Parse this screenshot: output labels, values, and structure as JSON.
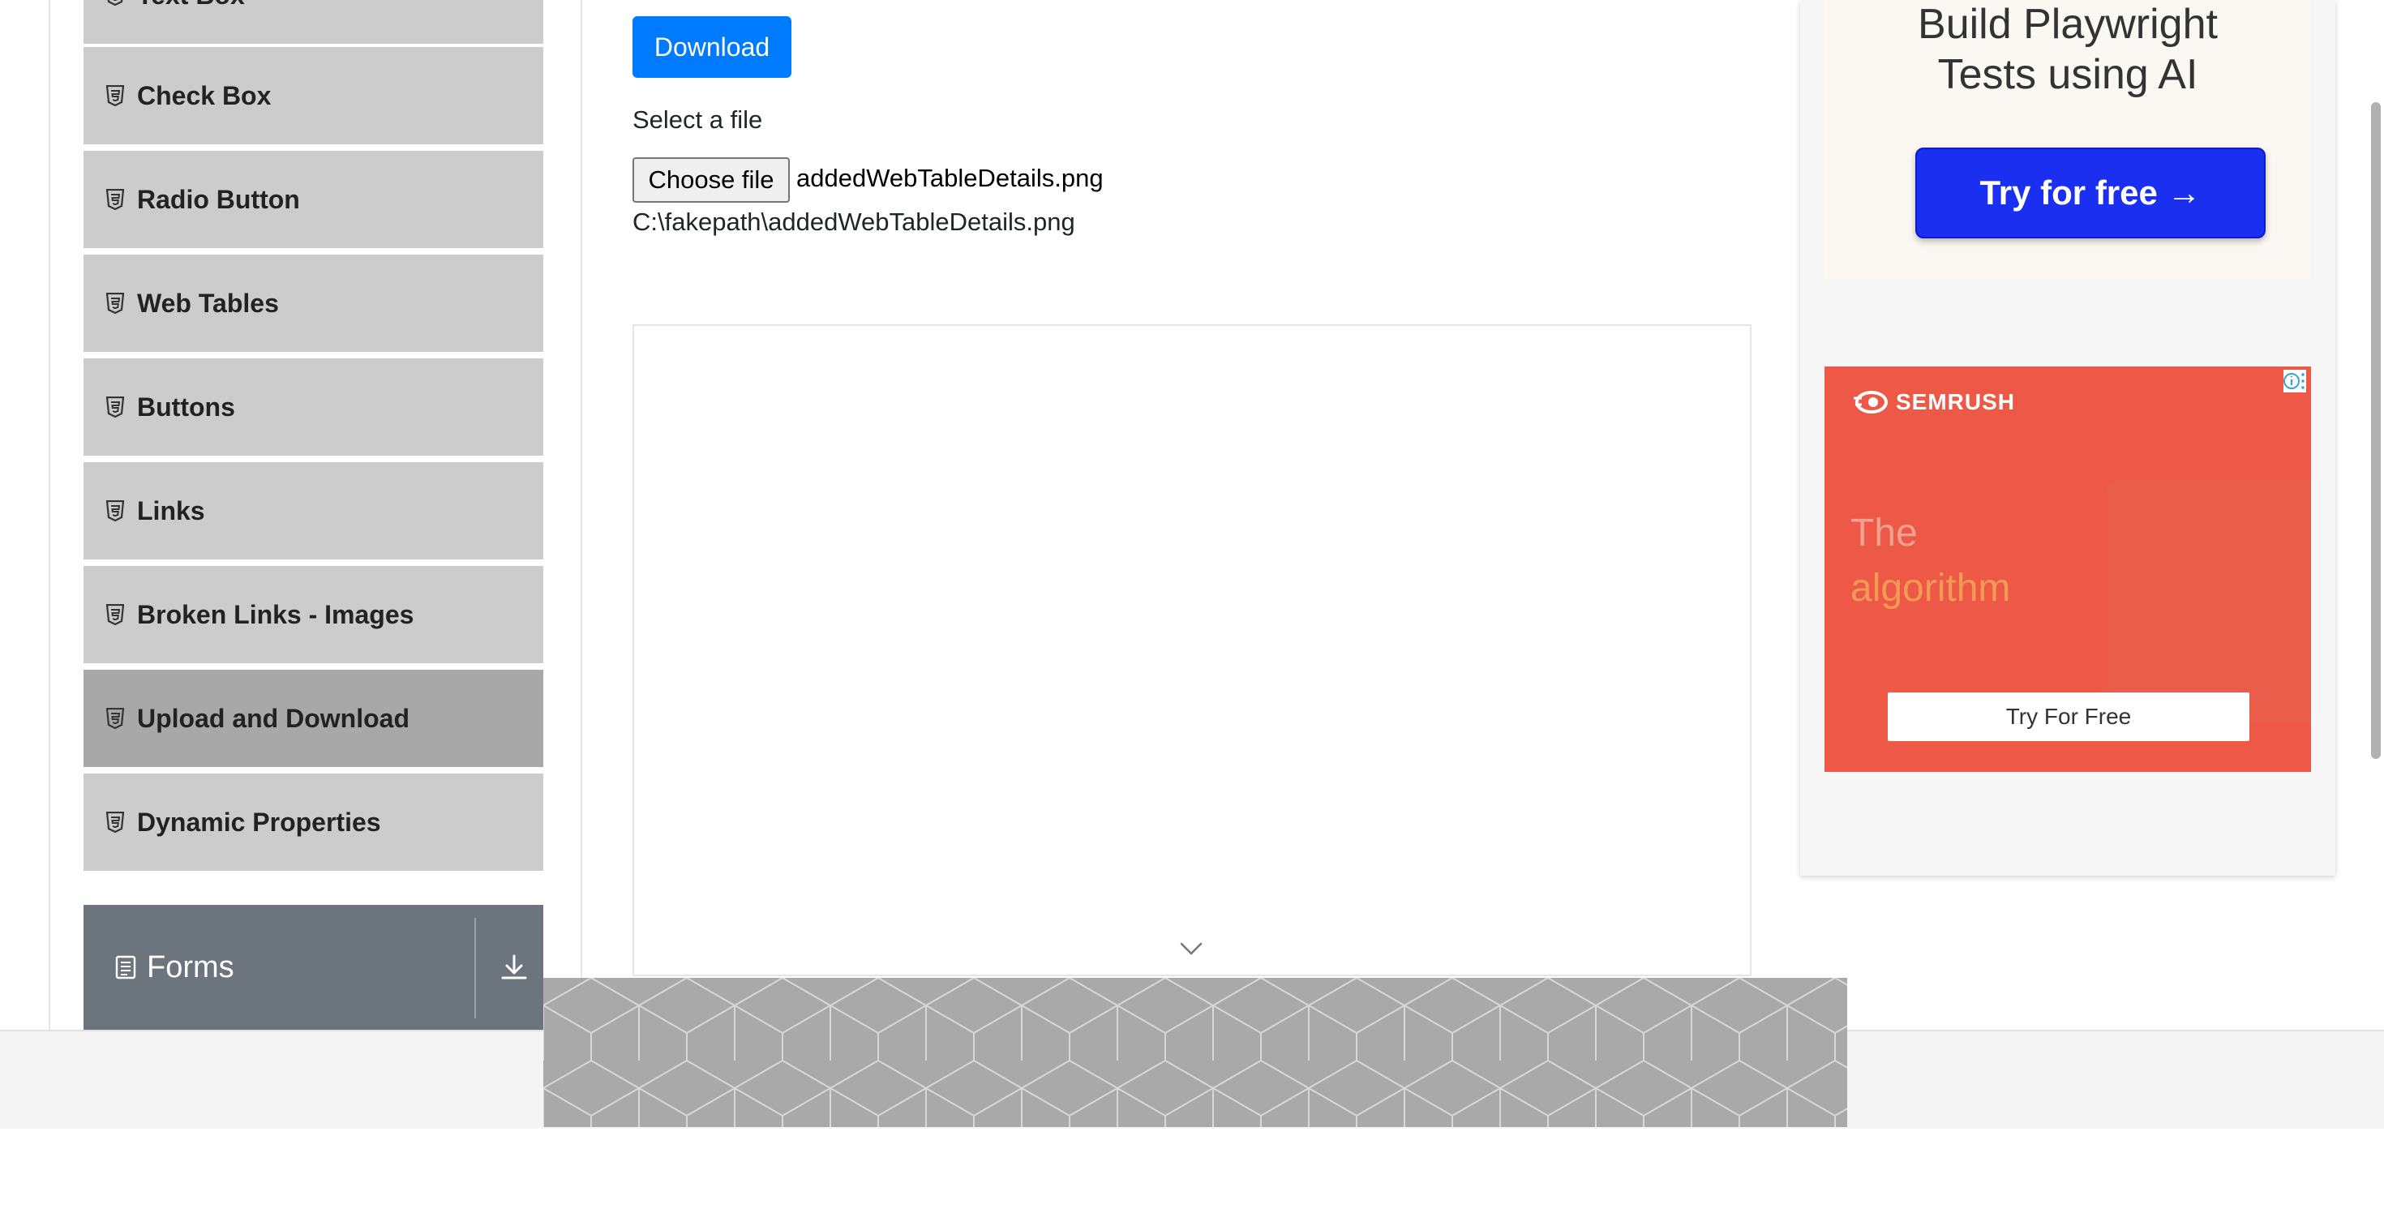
{
  "sidebar": {
    "items": [
      {
        "label": "Text Box",
        "active": false
      },
      {
        "label": "Check Box",
        "active": false
      },
      {
        "label": "Radio Button",
        "active": false
      },
      {
        "label": "Web Tables",
        "active": false
      },
      {
        "label": "Buttons",
        "active": false
      },
      {
        "label": "Links",
        "active": false
      },
      {
        "label": "Broken Links - Images",
        "active": false
      },
      {
        "label": "Upload and Download",
        "active": true
      },
      {
        "label": "Dynamic Properties",
        "active": false
      }
    ],
    "item_icon": "html5-icon",
    "forms_group": {
      "label": "Forms",
      "icon": "document-icon",
      "toggle_icon": "download-arrow-icon"
    }
  },
  "main": {
    "download_button": "Download",
    "select_label": "Select a file",
    "file_input": {
      "button_label": "Choose file",
      "file_name": "addedWebTableDetails.png"
    },
    "uploaded_path": "C:\\fakepath\\addedWebTableDetails.png"
  },
  "right_ads": {
    "playwright": {
      "title_line1": "Build Playwright",
      "title_line2": "Tests using AI",
      "cta": "Try for free →"
    },
    "semrush": {
      "brand": "SEMRUSH",
      "headline_line1": "The",
      "headline_line2": "algorithm",
      "cta": "Try For Free"
    }
  },
  "colors": {
    "primary": "#007bff",
    "sidebar_item": "#cccccc",
    "sidebar_active": "#a8a8a8",
    "forms_group": "#6c757d",
    "semrush": "#ee5846",
    "playwright_cta": "#1a2ff0"
  }
}
